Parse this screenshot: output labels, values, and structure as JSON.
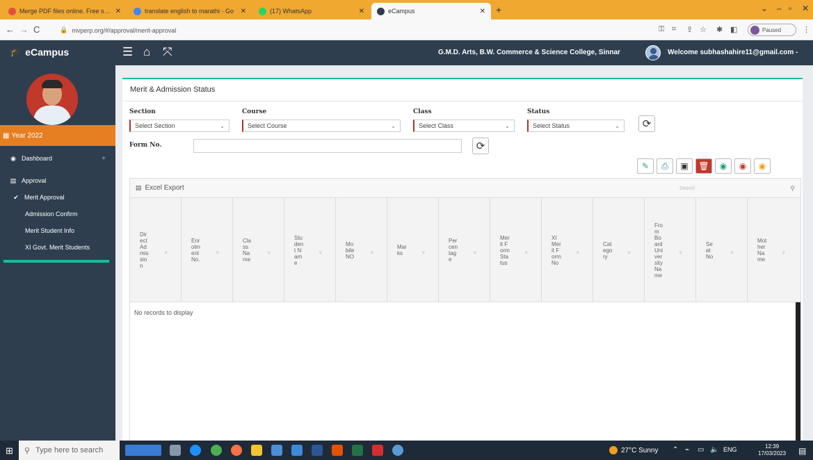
{
  "browser": {
    "tabs": [
      {
        "title": "Merge PDF files online. Free serv",
        "color": "#e74c3c",
        "active": false
      },
      {
        "title": "translate english to marathi - Go",
        "color": "#4285f4",
        "active": false
      },
      {
        "title": "(17) WhatsApp",
        "color": "#25d366",
        "active": false
      },
      {
        "title": "eCampus",
        "color": "#2f3e4f",
        "active": true
      }
    ],
    "url": "mvperp.org/#/approval/merit-approval",
    "profile_status": "Paused"
  },
  "header": {
    "brand": "eCampus",
    "college": "G.M.D. Arts, B.W. Commerce & Science College, Sinnar",
    "welcome": "Welcome subhashahire11@gmail.com -"
  },
  "sidebar": {
    "year": "Year 2022",
    "items": [
      {
        "label": "Dashboard",
        "icon": "dashboard-icon"
      },
      {
        "label": "Approval",
        "icon": "approval-icon"
      },
      {
        "label": "Merit Approval",
        "icon": "check-icon"
      },
      {
        "label": "Admission Confirm",
        "icon": ""
      },
      {
        "label": "Merit Student Info",
        "icon": ""
      },
      {
        "label": "XI Govt. Merit Students",
        "icon": ""
      }
    ]
  },
  "main": {
    "title": "Merit & Admission Status",
    "filters": {
      "section_label": "Section",
      "section_value": "Select Section",
      "course_label": "Course",
      "course_value": "Select Course",
      "class_label": "Class",
      "class_value": "Select Class",
      "status_label": "Status",
      "status_value": "Select Status",
      "form_label": "Form No.",
      "form_value": ""
    },
    "grid": {
      "excel_label": "Excel Export",
      "search_placeholder": "Search",
      "columns": [
        "Direct Admission",
        "Enrolment No.",
        "Class Name",
        "Student Name",
        "Mobile NO",
        "Marks",
        "Percentage",
        "Merit Form Status",
        "XI Merit Form No",
        "Category",
        "From Board University Name",
        "Seat No",
        "Mother Name"
      ],
      "empty_message": "No records to display"
    }
  },
  "taskbar": {
    "search_placeholder": "Type here to search",
    "weather": "27°C Sunny",
    "lang": "ENG",
    "time": "12:39",
    "date": "17/03/2023"
  }
}
